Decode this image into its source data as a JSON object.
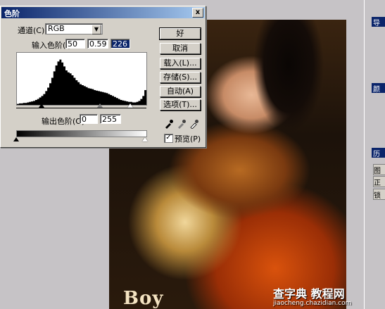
{
  "dialog": {
    "title": "色阶",
    "close_label": "x",
    "channel_label": "通道(C):",
    "channel_value": "RGB",
    "input_levels_label": "输入色阶(I):",
    "input_black": "50",
    "input_gamma": "0.59",
    "input_white": "226",
    "output_levels_label": "输出色阶(O):",
    "output_black": "0",
    "output_white": "255",
    "preview_label": "预览(P)",
    "preview_checked": true,
    "preview_mark": "✓"
  },
  "buttons": {
    "ok": "好",
    "cancel": "取消",
    "load": "载入(L)...",
    "save": "存储(S)...",
    "auto": "自动(A)",
    "options": "选项(T)..."
  },
  "image": {
    "overlay_text": "Boy",
    "watermark_title": "查字典 教程网",
    "watermark_url": "jiaocheng.chazidian.com"
  },
  "histogram": {
    "shape_description_values": [
      2,
      3,
      3,
      4,
      4,
      5,
      6,
      7,
      8,
      10,
      12,
      15,
      18,
      22,
      28,
      35,
      44,
      55,
      68,
      80,
      88,
      92,
      86,
      78,
      70,
      66,
      64,
      60,
      55,
      50,
      46,
      42,
      40,
      38,
      36,
      34,
      33,
      32,
      30,
      29,
      28,
      27,
      26,
      25,
      24,
      22,
      20,
      18,
      16,
      14,
      12,
      10,
      9,
      8,
      7,
      6,
      6,
      5,
      5,
      6,
      8,
      12,
      18,
      30
    ]
  },
  "palettes": {
    "labels": [
      "导",
      "颜",
      "历",
      "图",
      "正",
      "锁"
    ]
  }
}
